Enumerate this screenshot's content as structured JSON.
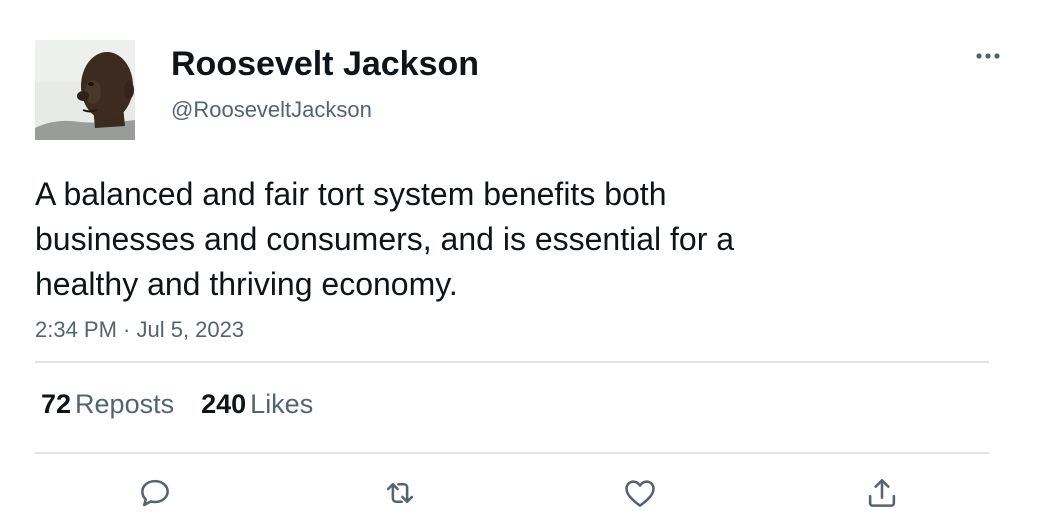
{
  "user": {
    "display_name": "Roosevelt Jackson",
    "handle": "@RooseveltJackson",
    "avatar_icon": "profile-photo"
  },
  "tweet": {
    "text": "A balanced and fair tort system benefits both businesses and consumers, and is essential for a healthy and thriving economy.",
    "timestamp": "2:34 PM · Jul 5, 2023"
  },
  "stats": {
    "reposts_count": "72",
    "reposts_label": "Reposts",
    "likes_count": "240",
    "likes_label": "Likes"
  },
  "actions": {
    "more_icon": "more-horizontal-icon",
    "reply_icon": "reply-icon",
    "repost_icon": "repost-icon",
    "like_icon": "heart-icon",
    "share_icon": "share-icon"
  },
  "colors": {
    "text_primary": "#0f1419",
    "text_secondary": "#536471",
    "divider": "#dfe3e6"
  }
}
